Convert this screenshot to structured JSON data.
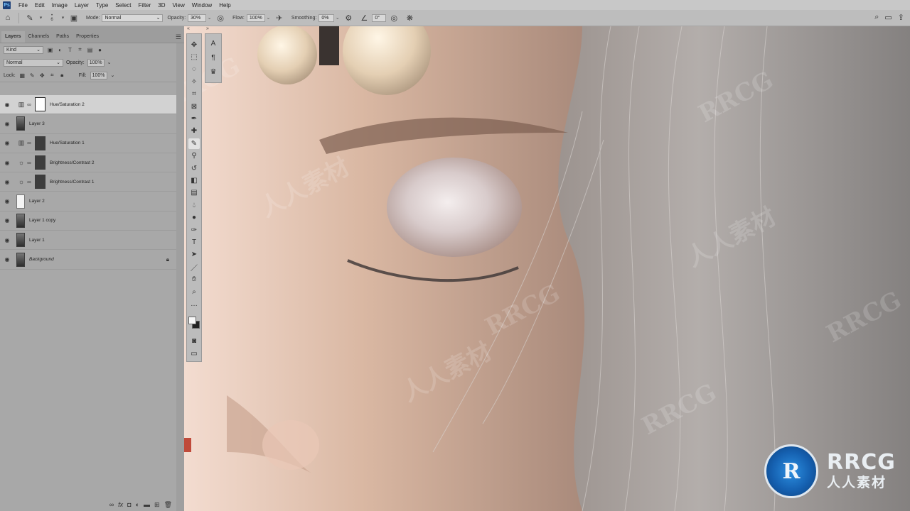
{
  "menu": {
    "app_icon_label": "Ps",
    "items": [
      "File",
      "Edit",
      "Image",
      "Layer",
      "Type",
      "Select",
      "Filter",
      "3D",
      "View",
      "Window",
      "Help"
    ]
  },
  "options_bar": {
    "brush_size": "6",
    "mode_label": "Mode:",
    "mode_value": "Normal",
    "opacity_label": "Opacity:",
    "opacity_value": "30%",
    "flow_label": "Flow:",
    "flow_value": "100%",
    "smoothing_label": "Smoothing:",
    "smoothing_value": "0%",
    "angle_value": "0°"
  },
  "layers_panel": {
    "tabs": [
      "Layers",
      "Channels",
      "Paths",
      "Properties"
    ],
    "filter_kind": "Kind",
    "blend_mode": "Normal",
    "opacity_label": "Opacity:",
    "opacity_value": "100%",
    "lock_label": "Lock:",
    "fill_label": "Fill:",
    "fill_value": "100%",
    "layers": [
      {
        "name": "Hue/Saturation 2",
        "type": "hue-sat",
        "selected": true
      },
      {
        "name": "Layer 3",
        "type": "photo"
      },
      {
        "name": "Hue/Saturation 1",
        "type": "hue-sat"
      },
      {
        "name": "Brightness/Contrast 2",
        "type": "brightness"
      },
      {
        "name": "Brightness/Contrast 1",
        "type": "brightness"
      },
      {
        "name": "Layer 2",
        "type": "white"
      },
      {
        "name": "Layer 1 copy",
        "type": "photo"
      },
      {
        "name": "Layer 1",
        "type": "photo"
      },
      {
        "name": "Background",
        "type": "background",
        "locked": true
      }
    ]
  },
  "watermark": {
    "latin": "RRCG",
    "chinese": "人人素材"
  },
  "logo": {
    "big": "RRCG",
    "small": "人人素材"
  }
}
